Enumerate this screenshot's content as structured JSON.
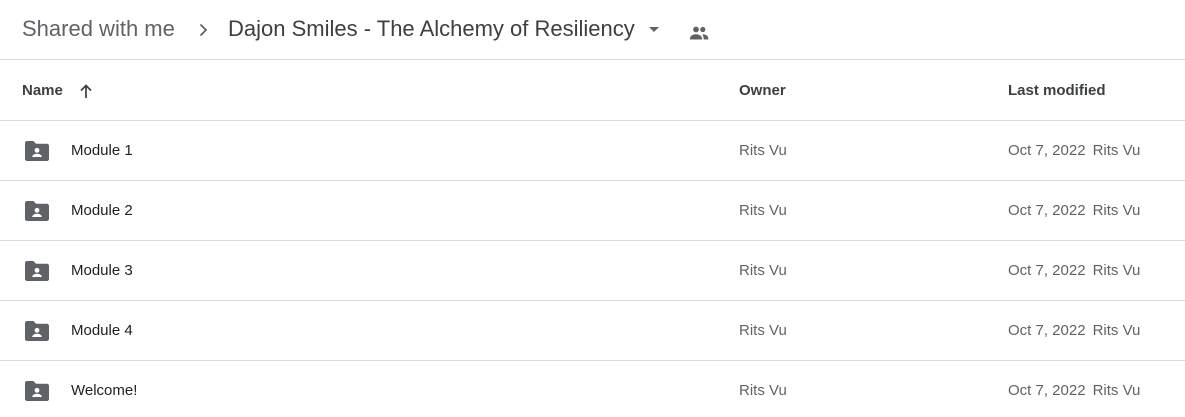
{
  "breadcrumb": {
    "root": "Shared with me",
    "separator_icon": "chevron-right-icon",
    "current_folder": "Dajon Smiles - The Alchemy of Resiliency",
    "dropdown_icon": "caret-down-icon",
    "shared_icon": "people-icon"
  },
  "columns": {
    "name": "Name",
    "sort_icon": "arrow-up-icon",
    "owner": "Owner",
    "last_modified": "Last modified"
  },
  "files": [
    {
      "name": "Module 1",
      "icon": "shared-folder-icon",
      "owner": "Rits Vu",
      "modified_date": "Oct 7, 2022",
      "modified_by": "Rits Vu"
    },
    {
      "name": "Module 2",
      "icon": "shared-folder-icon",
      "owner": "Rits Vu",
      "modified_date": "Oct 7, 2022",
      "modified_by": "Rits Vu"
    },
    {
      "name": "Module 3",
      "icon": "shared-folder-icon",
      "owner": "Rits Vu",
      "modified_date": "Oct 7, 2022",
      "modified_by": "Rits Vu"
    },
    {
      "name": "Module 4",
      "icon": "shared-folder-icon",
      "owner": "Rits Vu",
      "modified_date": "Oct 7, 2022",
      "modified_by": "Rits Vu"
    },
    {
      "name": "Welcome!",
      "icon": "shared-folder-icon",
      "owner": "Rits Vu",
      "modified_date": "Oct 7, 2022",
      "modified_by": "Rits Vu"
    }
  ],
  "colors": {
    "icon_gray": "#5f6368",
    "divider": "#dadce0",
    "text_primary": "#202124",
    "text_secondary": "#5f6368"
  }
}
